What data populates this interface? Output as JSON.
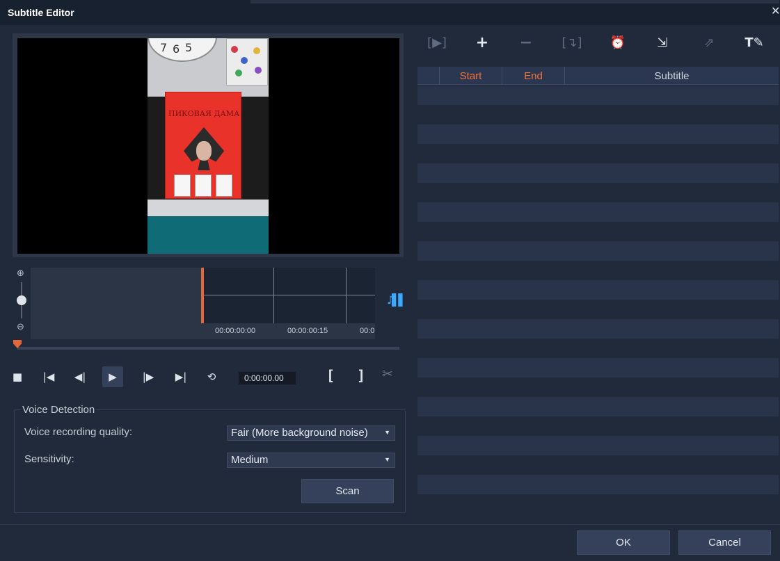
{
  "window": {
    "title": "Subtitle Editor",
    "close_symbol": "✕"
  },
  "timeline": {
    "labels": [
      "00:00:00:00",
      "00:00:00:15",
      "00:0"
    ]
  },
  "transport": {
    "timecode": "0:00:00.00"
  },
  "voice_detection": {
    "group_title": "Voice Detection",
    "quality_label": "Voice recording quality:",
    "quality_value": "Fair (More background noise)",
    "sensitivity_label": "Sensitivity:",
    "sensitivity_value": "Medium",
    "scan_label": "Scan"
  },
  "subtitle_table": {
    "columns": [
      "",
      "Start",
      "End",
      "Subtitle"
    ],
    "rows": []
  },
  "footer": {
    "ok_label": "OK",
    "cancel_label": "Cancel"
  },
  "colors": {
    "accent": "#f0743c",
    "audio_icon": "#3ba9ff",
    "background": "#202a3a"
  },
  "icons": {
    "toolbar": [
      "play-subtitle-icon",
      "add-icon",
      "remove-icon",
      "merge-icon",
      "alarm-icon",
      "import-icon",
      "export-icon",
      "text-format-icon"
    ],
    "transport": [
      "stop-icon",
      "go-to-start-icon",
      "previous-frame-icon",
      "play-icon",
      "next-frame-icon",
      "go-to-end-icon",
      "repeat-icon"
    ]
  }
}
